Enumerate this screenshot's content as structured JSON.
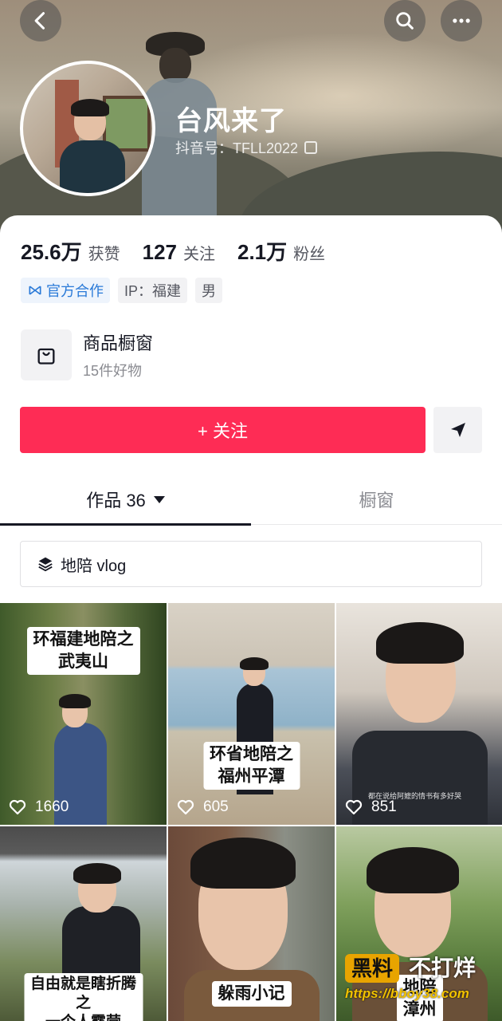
{
  "header": {
    "nickname": "台风来了",
    "douyin_id": "抖音号：TFLL2022"
  },
  "stats": [
    {
      "value": "25.6万",
      "label": "获赞"
    },
    {
      "value": "127",
      "label": "关注"
    },
    {
      "value": "2.1万",
      "label": "粉丝"
    }
  ],
  "tags": {
    "official": "官方合作",
    "ip": "IP：福建",
    "gender": "男"
  },
  "shop": {
    "title": "商品橱窗",
    "subtitle": "15件好物"
  },
  "actions": {
    "follow_label": "+ 关注"
  },
  "tabs": {
    "works": "作品 36",
    "window": "橱窗"
  },
  "collection": {
    "label": "地陪 vlog"
  },
  "videos": [
    {
      "caption_line1": "环福建地陪之",
      "caption_line2": "武夷山",
      "likes": "1660"
    },
    {
      "caption_line1": "环省地陪之",
      "caption_line2": "福州平潭",
      "likes": "605"
    },
    {
      "caption_line1": "",
      "caption_line2": "",
      "subtext": "都在说给阿嬷的情书有多好哭",
      "likes": "851"
    },
    {
      "caption_line1": "自由就是瞎折腾",
      "caption_line2": "之",
      "caption_line3": "一个人露营",
      "likes": ""
    },
    {
      "caption_line1": "躲雨小记",
      "caption_line2": "",
      "likes": ""
    },
    {
      "caption_line1": "地陪",
      "caption_line2": "漳州",
      "likes": ""
    }
  ],
  "watermark": {
    "box": "黑料",
    "text": "不打烊",
    "url": "https://bboy38.com"
  },
  "colors": {
    "follow_red": "#fe2c55",
    "official_blue": "#2a7ad8",
    "watermark_gold": "#e8a400"
  }
}
